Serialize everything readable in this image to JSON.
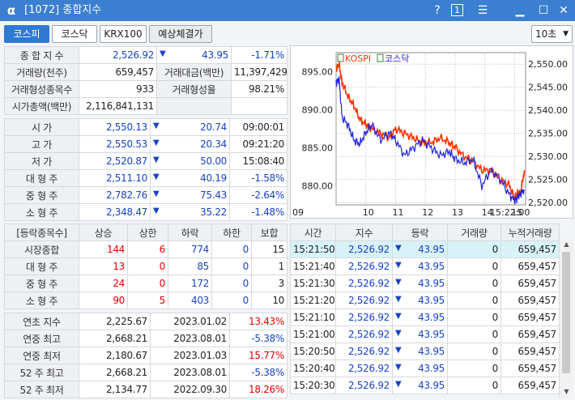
{
  "window": {
    "title": "[1072] 종합지수",
    "help": "?",
    "badge": "1"
  },
  "tabs": [
    {
      "label": "코스피"
    },
    {
      "label": "코스닥"
    },
    {
      "label": "KRX100"
    },
    {
      "label": "예상체결가"
    }
  ],
  "interval": {
    "value": "10초"
  },
  "index_summary": {
    "rows": [
      [
        "종 합 지 수",
        "2,526.92",
        "43.95",
        "-1.71%"
      ],
      [
        "거래량(천주)",
        "659,457",
        "거래대금(백만)",
        "11,397,429"
      ],
      [
        "거래형성종목수",
        "933",
        "거래형성율",
        "98.21%"
      ],
      [
        "시가총액(백만)",
        "2,116,841,131",
        "",
        ""
      ]
    ]
  },
  "ohlc": [
    {
      "label": "시 가",
      "value": "2,550.13",
      "change": "20.74",
      "time": "09:00:01"
    },
    {
      "label": "고 가",
      "value": "2,550.53",
      "change": "20.34",
      "time": "09:21:20"
    },
    {
      "label": "저 가",
      "value": "2,520.87",
      "change": "50.00",
      "time": "15:08:40"
    },
    {
      "label": "대 형 주",
      "value": "2,511.10",
      "change": "40.19",
      "time": "-1.58%"
    },
    {
      "label": "중 형 주",
      "value": "2,782.76",
      "change": "75.43",
      "time": "-2.64%"
    },
    {
      "label": "소 형 주",
      "value": "2,348.47",
      "change": "35.22",
      "time": "-1.48%"
    }
  ],
  "breadth": {
    "headers": [
      "[등락종목수]",
      "상승",
      "상한",
      "하락",
      "하한",
      "보합"
    ],
    "rows": [
      [
        "시장종합",
        "144",
        "6",
        "774",
        "0",
        "15"
      ],
      [
        "대 형 주",
        "13",
        "0",
        "85",
        "0",
        "1"
      ],
      [
        "중 형 주",
        "24",
        "0",
        "172",
        "0",
        "3"
      ],
      [
        "소 형 주",
        "90",
        "5",
        "403",
        "0",
        "10"
      ]
    ]
  },
  "yearly": [
    [
      "연초 지수",
      "2,225.67",
      "2023.01.02",
      "13.43%"
    ],
    [
      "연중 최고",
      "2,668.21",
      "2023.08.01",
      "-5.38%"
    ],
    [
      "연중 최저",
      "2,180.67",
      "2023.01.03",
      "15.77%"
    ],
    [
      "52 주 최고",
      "2,668.21",
      "2023.08.01",
      "-5.38%"
    ],
    [
      "52 주 최저",
      "2,134.77",
      "2022.09.30",
      "18.26%"
    ]
  ],
  "ticks": {
    "headers": [
      "시간",
      "지수",
      "등락",
      "거래량",
      "누적거래량"
    ],
    "rows": [
      [
        "15:21:50",
        "2,526.92",
        "43.95",
        "0",
        "659,457"
      ],
      [
        "15:21:40",
        "2,526.92",
        "43.95",
        "0",
        "659,457"
      ],
      [
        "15:21:30",
        "2,526.92",
        "43.95",
        "0",
        "659,457"
      ],
      [
        "15:21:20",
        "2,526.92",
        "43.95",
        "0",
        "659,457"
      ],
      [
        "15:21:10",
        "2,526.92",
        "43.95",
        "0",
        "659,457"
      ],
      [
        "15:21:00",
        "2,526.92",
        "43.95",
        "0",
        "659,457"
      ],
      [
        "15:20:50",
        "2,526.92",
        "43.95",
        "0",
        "659,457"
      ],
      [
        "15:20:40",
        "2,526.92",
        "43.95",
        "0",
        "659,457"
      ],
      [
        "15:20:30",
        "2,526.92",
        "43.95",
        "0",
        "659,457"
      ]
    ]
  },
  "chart_data": {
    "type": "line",
    "series": [
      {
        "name": "KOSPI",
        "color": "#ff3300",
        "axis": "right",
        "points": [
          [
            9.0,
            2549
          ],
          [
            9.1,
            2550
          ],
          [
            9.2,
            2546
          ],
          [
            9.4,
            2543
          ],
          [
            9.6,
            2541
          ],
          [
            9.8,
            2538
          ],
          [
            10.0,
            2537
          ],
          [
            10.2,
            2536
          ],
          [
            10.5,
            2535
          ],
          [
            10.8,
            2534
          ],
          [
            11.0,
            2536
          ],
          [
            11.3,
            2535
          ],
          [
            11.6,
            2534
          ],
          [
            11.9,
            2533
          ],
          [
            12.2,
            2533
          ],
          [
            12.5,
            2534
          ],
          [
            12.8,
            2533
          ],
          [
            13.0,
            2532
          ],
          [
            13.3,
            2530
          ],
          [
            13.6,
            2529
          ],
          [
            13.9,
            2527
          ],
          [
            14.2,
            2527
          ],
          [
            14.5,
            2525
          ],
          [
            14.8,
            2524
          ],
          [
            15.0,
            2521
          ],
          [
            15.1,
            2522
          ],
          [
            15.2,
            2522
          ],
          [
            15.33,
            2527
          ]
        ]
      },
      {
        "name": "코스닥",
        "color": "#2222dd",
        "axis": "left",
        "points": [
          [
            9.0,
            893.5
          ],
          [
            9.1,
            894
          ],
          [
            9.2,
            889
          ],
          [
            9.4,
            888
          ],
          [
            9.6,
            886
          ],
          [
            9.8,
            885.5
          ],
          [
            10.0,
            887
          ],
          [
            10.2,
            888
          ],
          [
            10.5,
            886
          ],
          [
            10.8,
            887
          ],
          [
            11.0,
            886
          ],
          [
            11.3,
            884
          ],
          [
            11.6,
            885
          ],
          [
            11.9,
            886
          ],
          [
            12.2,
            885
          ],
          [
            12.5,
            884
          ],
          [
            12.8,
            884.5
          ],
          [
            13.0,
            883.5
          ],
          [
            13.3,
            883
          ],
          [
            13.6,
            883.5
          ],
          [
            13.9,
            880
          ],
          [
            14.2,
            882
          ],
          [
            14.5,
            881
          ],
          [
            14.8,
            879
          ],
          [
            15.0,
            878
          ],
          [
            15.1,
            878.5
          ],
          [
            15.2,
            879
          ],
          [
            15.33,
            879.5
          ]
        ]
      }
    ],
    "x_ticks": [
      "09",
      "10",
      "11",
      "12",
      "13",
      "14",
      "15",
      "15:22:00"
    ],
    "left_ticks": [
      "895.00",
      "890.00",
      "885.00",
      "880.00"
    ],
    "right_ticks": [
      "2,550.00",
      "2,545.00",
      "2,540.00",
      "2,535.00",
      "2,530.00",
      "2,525.00",
      "2,520.00"
    ],
    "left_ylim": [
      877.5,
      897.5
    ],
    "right_ylim": [
      2519.5,
      2552.5
    ],
    "xlim": [
      9.0,
      15.37
    ],
    "grid": true,
    "legend": "top-left"
  }
}
